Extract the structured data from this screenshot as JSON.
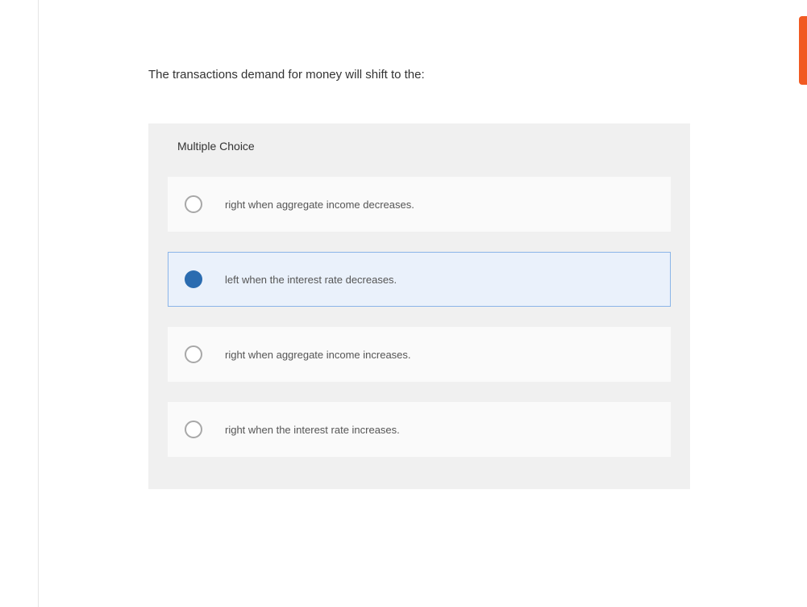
{
  "question": "The transactions demand for money will shift to the:",
  "quiz_type_label": "Multiple Choice",
  "options": [
    {
      "text": "right when aggregate income decreases.",
      "selected": false
    },
    {
      "text": "left when the interest rate decreases.",
      "selected": true
    },
    {
      "text": "right when aggregate income increases.",
      "selected": false
    },
    {
      "text": "right when the interest rate increases.",
      "selected": false
    }
  ]
}
